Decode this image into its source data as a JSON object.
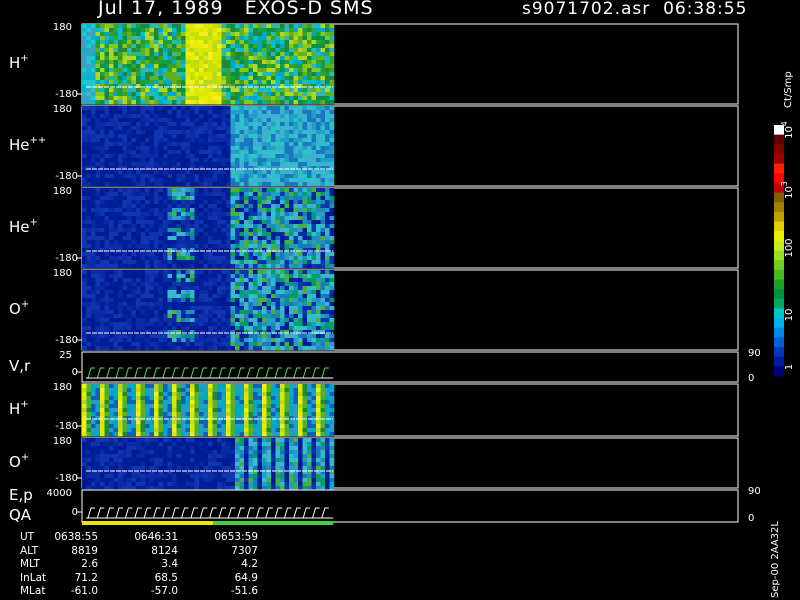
{
  "header": {
    "date": "Jul 17, 1989",
    "instrument": "EXOS-D SMS",
    "file": "s9071702.asr",
    "time": "06:38:55"
  },
  "colorbar": {
    "unit": "Ct/Smp",
    "tick_labels": [
      "1",
      "10",
      "100",
      "10",
      "10"
    ],
    "tick_exponents": [
      "",
      "",
      "",
      "3",
      "4"
    ],
    "colors": [
      "#00007a",
      "#001aa0",
      "#0038c0",
      "#0060d8",
      "#0088e8",
      "#00b0f0",
      "#00c8c8",
      "#00a860",
      "#009040",
      "#20a020",
      "#48b820",
      "#70d020",
      "#98e020",
      "#c0f020",
      "#e8f000",
      "#e0d000",
      "#c0a000",
      "#a08000",
      "#806000",
      "#c00000",
      "#ff0000",
      "#ff2000",
      "#a00000",
      "#800000",
      "#600000",
      "#ffffff"
    ]
  },
  "chart_data": {
    "type": "heatmap",
    "x_time_range": [
      "06:38:55",
      "06:53:59"
    ],
    "panels": [
      {
        "label": "H",
        "sup": "+",
        "ymax": "180",
        "ymin": "-180",
        "data_extent": 0.383,
        "style": "dense"
      },
      {
        "label": "He",
        "sup": "++",
        "ymax": "180",
        "ymin": "-180",
        "data_extent": 0.383,
        "style": "faint"
      },
      {
        "label": "He",
        "sup": "+",
        "ymax": "180",
        "ymin": "-180",
        "data_extent": 0.383,
        "style": "patchy"
      },
      {
        "label": "O",
        "sup": "+",
        "ymax": "180",
        "ymin": "-180",
        "data_extent": 0.383,
        "style": "patchy"
      },
      {
        "label": "V,r",
        "sup": "",
        "ymax": "25",
        "ymin": "0",
        "right_top": "90",
        "right_bottom": "0",
        "data_extent": 0.383,
        "style": "line"
      },
      {
        "label": "H",
        "sup": "+",
        "ymax": "180",
        "ymin": "-180",
        "data_extent": 0.383,
        "style": "stripes"
      },
      {
        "label": "O",
        "sup": "+",
        "ymax": "180",
        "ymin": "-180",
        "data_extent": 0.383,
        "style": "stripes-faint"
      },
      {
        "label": "E,p",
        "label2": "QA",
        "sup": "",
        "ymax": "4000",
        "ymin": "0",
        "right_top": "90",
        "right_bottom": "0",
        "data_extent": 0.383,
        "style": "line"
      }
    ],
    "qa_bar": [
      {
        "from": 0.0,
        "to": 0.2,
        "color": "#e8e800"
      },
      {
        "from": 0.2,
        "to": 0.383,
        "color": "#40d040"
      }
    ]
  },
  "orbit_table": {
    "rows": [
      {
        "name": "UT",
        "values": [
          "0638:55",
          "0646:31",
          "0653:59"
        ]
      },
      {
        "name": "ALT",
        "values": [
          "8819",
          "8124",
          "7307"
        ]
      },
      {
        "name": "MLT",
        "values": [
          "2.6",
          "3.4",
          "4.2"
        ]
      },
      {
        "name": "InLat",
        "values": [
          "71.2",
          "68.5",
          "64.9"
        ]
      },
      {
        "name": "MLat",
        "values": [
          "-61.0",
          "-57.0",
          "-51.6"
        ]
      }
    ]
  },
  "side_label": "Sep-00  2AA32L"
}
